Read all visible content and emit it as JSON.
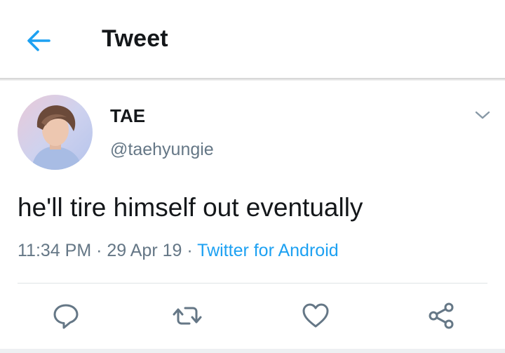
{
  "header": {
    "title": "Tweet",
    "back_icon": "arrow-left-icon",
    "accent": "#1da1f2"
  },
  "author": {
    "name": "TAE",
    "handle": "@taehyungie"
  },
  "tweet": {
    "text": "he'll tire himself out eventually",
    "time": "11:34 PM",
    "separator": " · ",
    "date": "29 Apr 19",
    "source": "Twitter for Android"
  },
  "actions": [
    {
      "name": "reply",
      "icon": "reply-icon"
    },
    {
      "name": "retweet",
      "icon": "retweet-icon"
    },
    {
      "name": "like",
      "icon": "heart-icon"
    },
    {
      "name": "share",
      "icon": "share-icon"
    }
  ],
  "colors": {
    "text": "#14171a",
    "secondary": "#657786",
    "link": "#1da1f2",
    "icon": "#657786"
  }
}
